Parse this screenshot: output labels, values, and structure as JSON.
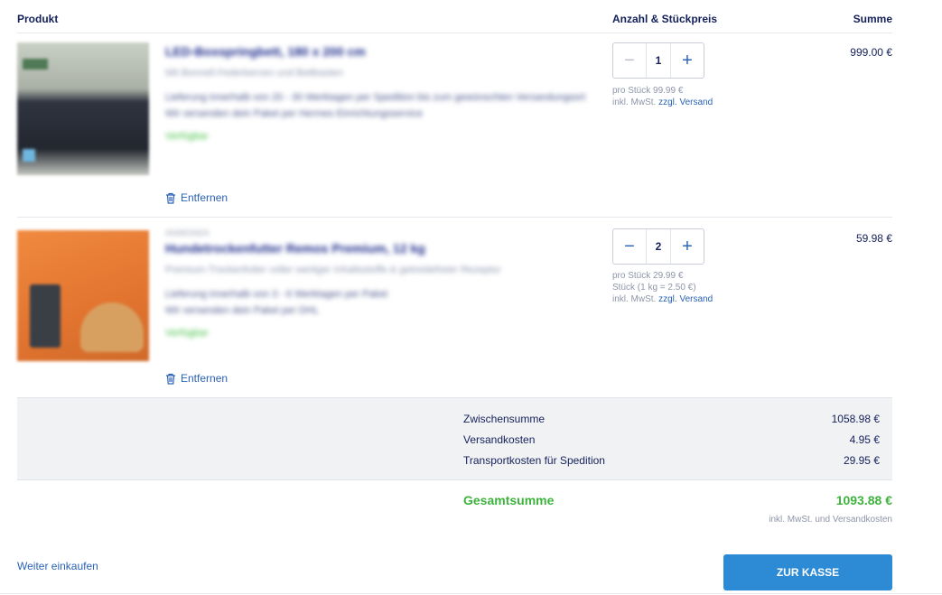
{
  "header": {
    "product": "Produkt",
    "qty_price": "Anzahl & Stückpreis",
    "sum": "Summe"
  },
  "items": [
    {
      "brand": "",
      "title": "LED-Boxspringbett, 180 x 200 cm",
      "subtitle": "Mit Bonnell-Federkernen und Bettkasten",
      "delivery_lines": [
        "Lieferung innerhalb von 20 - 30 Werktagen per Spedition bis zum gewünschten Versandungsort",
        "Wir versenden dein Paket per Hermes Einrichtungsservice"
      ],
      "availability": "Verfügbar",
      "remove": "Entfernen",
      "quantity": "1",
      "minus_disabled": true,
      "price_lines": [
        "pro Stück 99.99 €"
      ],
      "tax_prefix": "inkl. MwSt.",
      "shipping_link": "zzgl. Versand",
      "line_total": "999.00 €"
    },
    {
      "brand": "ANIMONDA",
      "title": "Hundetrockenfutter Remos Premium, 12 kg",
      "subtitle": "Premium-Trockenfutter voller wertiger Inhaltsstoffe & getreidefreier Rezeptur",
      "delivery_lines": [
        "Lieferung innerhalb von 3 - 6 Werktagen per Paket",
        "Wir versenden dein Paket per DHL"
      ],
      "availability": "Verfügbar",
      "remove": "Entfernen",
      "quantity": "2",
      "minus_disabled": false,
      "price_lines": [
        "pro Stück 29.99 €",
        "Stück (1 kg = 2.50 €)"
      ],
      "tax_prefix": "inkl. MwSt.",
      "shipping_link": "zzgl. Versand",
      "line_total": "59.98 €"
    }
  ],
  "totals": {
    "subtotal_label": "Zwischensumme",
    "subtotal_value": "1058.98 €",
    "shipping_label": "Versandkosten",
    "shipping_value": "4.95 €",
    "transport_label": "Transportkosten für Spedition",
    "transport_value": "29.95 €",
    "grand_label": "Gesamtsumme",
    "grand_value": "1093.88 €",
    "grand_note": "inkl. MwSt. und Versandkosten"
  },
  "actions": {
    "continue": "Weiter einkaufen",
    "checkout": "ZUR KASSE"
  },
  "icons": {
    "remove": "trash-icon",
    "minus": "minus-icon",
    "plus": "plus-icon"
  },
  "colors": {
    "accent": "#2d8bd6",
    "total_green": "#3db33d",
    "text_navy": "#14205a"
  }
}
